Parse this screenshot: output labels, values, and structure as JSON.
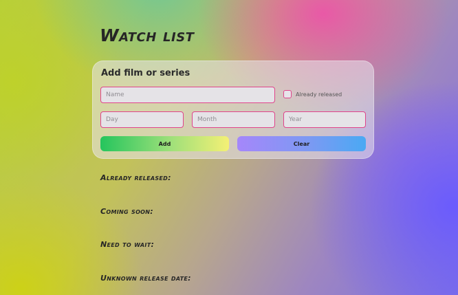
{
  "header": {
    "title": "Watch list"
  },
  "form": {
    "title": "Add film or series",
    "name_placeholder": "Name",
    "released_checkbox_label": "Already released",
    "released_checked": false,
    "day_placeholder": "Day",
    "month_placeholder": "Month",
    "year_placeholder": "Year",
    "add_label": "Add",
    "clear_label": "Clear"
  },
  "sections": {
    "already_released": "Already released:",
    "coming_soon": "Coming soon:",
    "need_to_wait": "Need to wait:",
    "unknown_release": "Unknown release date:"
  },
  "colors": {
    "field_border": "#e0438a",
    "add_gradient": [
      "#25c55d",
      "#f4f075"
    ],
    "clear_gradient": [
      "#a587fa",
      "#4aa9f3"
    ]
  }
}
